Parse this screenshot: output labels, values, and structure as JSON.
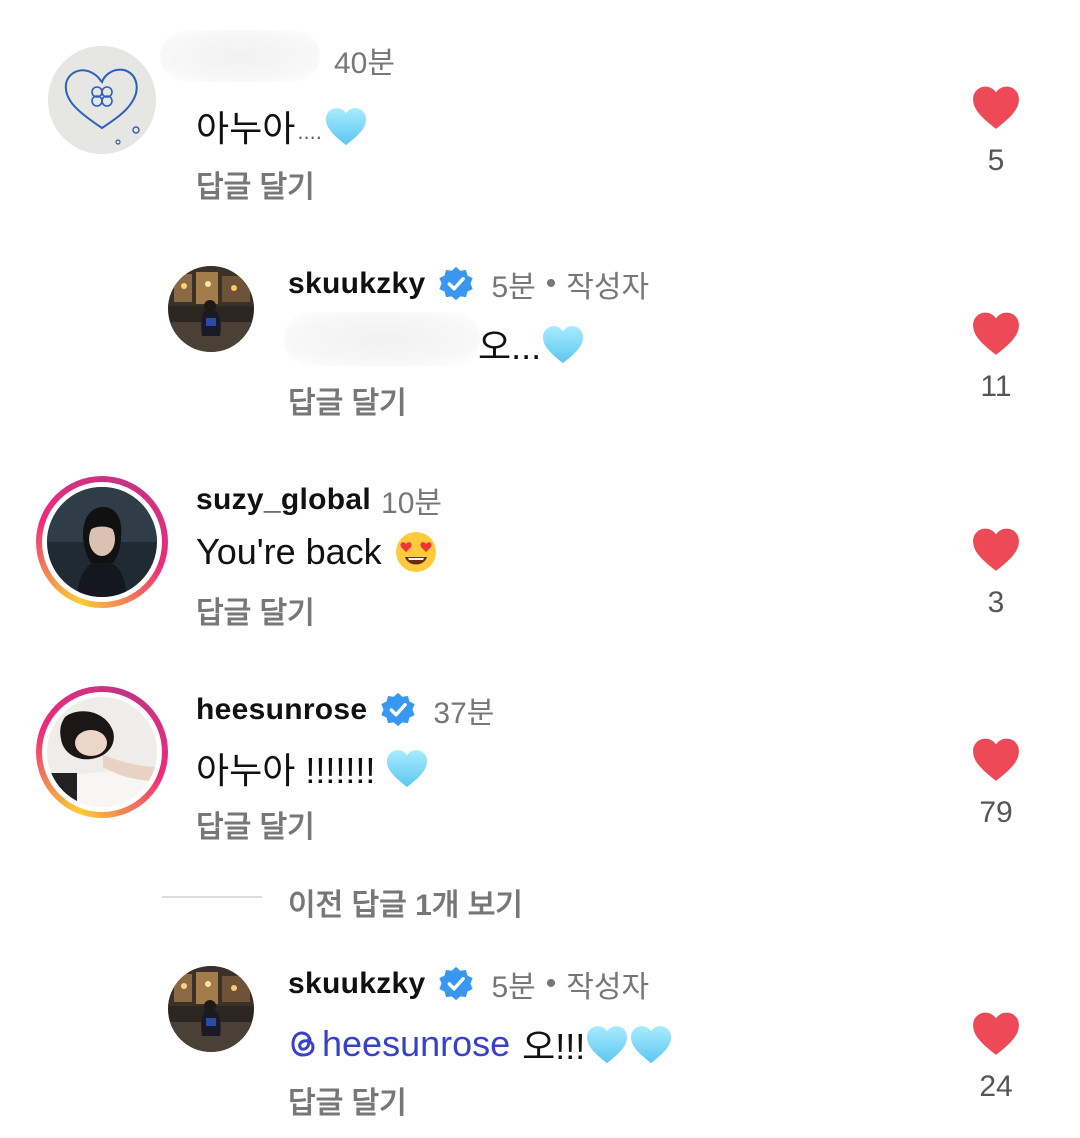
{
  "comments": [
    {
      "username": "",
      "time": "40분",
      "text": "아누아",
      "text_suffix": "....",
      "reply_label": "답글 달기",
      "likes": "5",
      "avatar": "heart-clover-doodle"
    },
    {
      "username": "skuukzky",
      "verified": true,
      "time": "5분",
      "separator": "•",
      "author_label": "작성자",
      "text": "오...",
      "reply_label": "답글 달기",
      "likes": "11",
      "avatar": "night-street-photo"
    },
    {
      "username": "suzy_global",
      "time": "10분",
      "text": "You're back",
      "reply_label": "답글 달기",
      "likes": "3",
      "avatar": "woman-portrait-dark",
      "story_ring": true
    },
    {
      "username": "heesunrose",
      "verified": true,
      "time": "37분",
      "text": "아누아 !!!!!!!",
      "reply_label": "답글 달기",
      "likes": "79",
      "avatar": "woman-lying-portrait",
      "story_ring": true
    },
    {
      "username": "skuukzky",
      "verified": true,
      "time": "5분",
      "separator": "•",
      "author_label": "작성자",
      "mention": "heesunrose",
      "text": "오!!!",
      "reply_label": "답글 달기",
      "likes": "24",
      "avatar": "night-street-photo"
    }
  ],
  "view_previous": "이전 답글 1개 보기",
  "colors": {
    "heart_like": "#ed4956",
    "verified_badge": "#3897f0",
    "mention": "#3940c9",
    "light_blue_heart": "#7fd7f7",
    "secondary_text": "#777777"
  }
}
